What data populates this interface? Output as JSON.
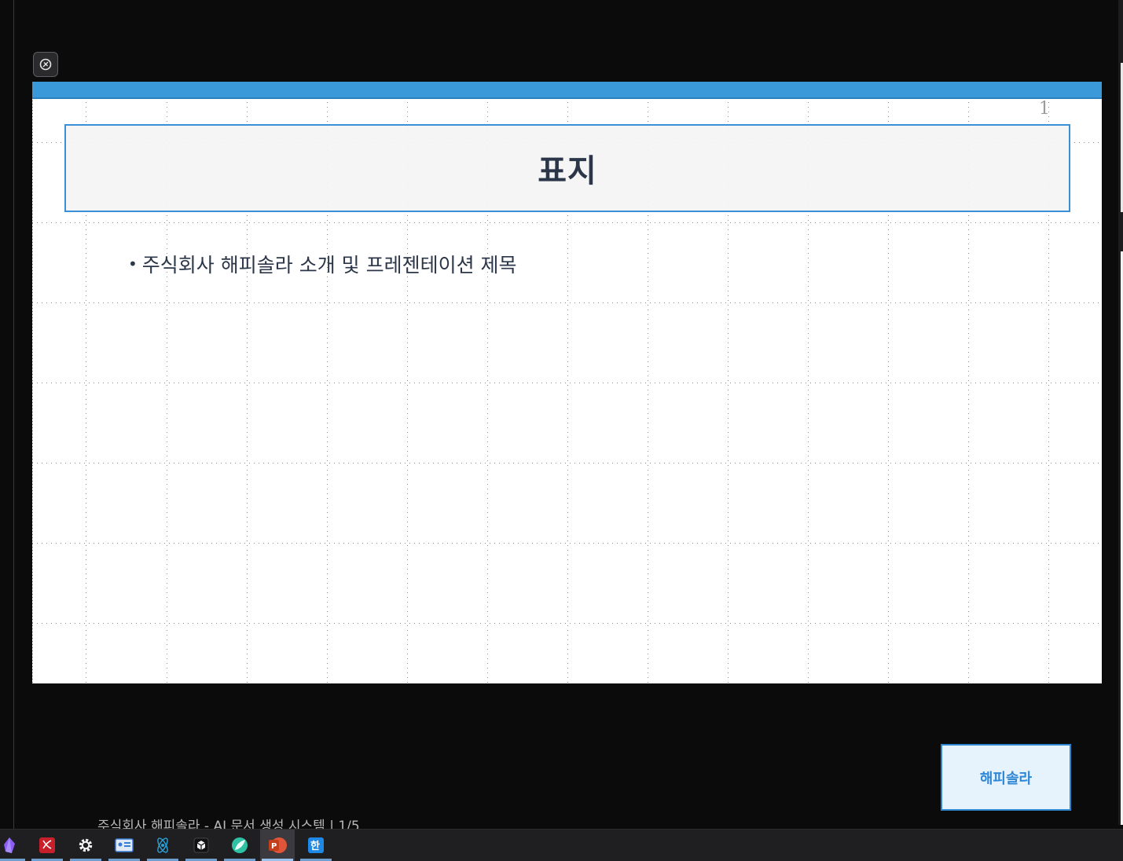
{
  "slide": {
    "page_number": "1",
    "title": "표지",
    "bullets": [
      "주식회사 해피솔라 소개 및 프레젠테이션 제목"
    ],
    "bullet_marker": "•"
  },
  "logo": {
    "label": "해피솔라"
  },
  "footer": {
    "text": "주식회사 해피솔라 - AI 문서 생성 시스템 | 1/5"
  },
  "taskbar": {
    "items": [
      {
        "name": "obsidian",
        "icon": "crystal-icon"
      },
      {
        "name": "pdf-app",
        "icon": "pdf-icon"
      },
      {
        "name": "settings",
        "icon": "gear-icon"
      },
      {
        "name": "id-card-app",
        "icon": "id-card-icon"
      },
      {
        "name": "electron-app",
        "icon": "electron-icon"
      },
      {
        "name": "dark-cube-app",
        "icon": "cube-icon"
      },
      {
        "name": "leaf-app",
        "icon": "leaf-icon"
      },
      {
        "name": "powerpoint",
        "icon": "powerpoint-icon",
        "active": true
      },
      {
        "name": "hangul",
        "icon": "hangul-icon"
      }
    ],
    "powerpoint_glyph": "P",
    "hangul_glyph": "한"
  },
  "colors": {
    "accent_blue": "#3a9ad9",
    "title_text": "#2b3648",
    "background": "#0b0b0c"
  }
}
